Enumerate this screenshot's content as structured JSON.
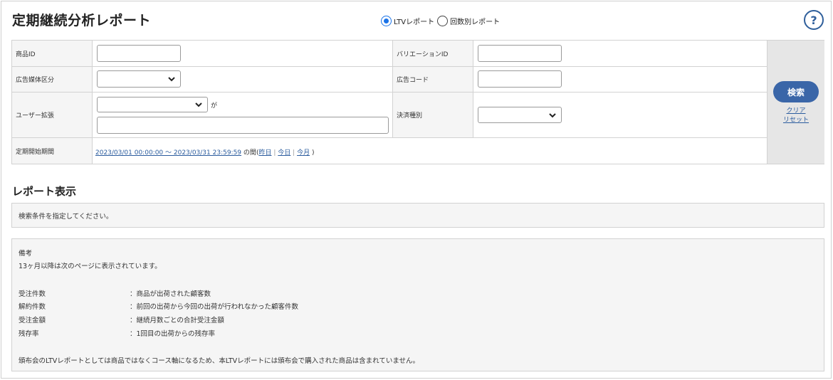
{
  "header": {
    "title": "定期継続分析レポート",
    "report_types": [
      {
        "label": "LTVレポート",
        "checked": true
      },
      {
        "label": "回数別レポート",
        "checked": false
      }
    ],
    "help_label": "?"
  },
  "search": {
    "product_id_label": "商品ID",
    "product_id_value": "",
    "variation_id_label": "バリエーションID",
    "variation_id_value": "",
    "ad_media_label": "広告媒体区分",
    "ad_media_value": "",
    "ad_code_label": "広告コード",
    "ad_code_value": "",
    "user_ext_label": "ユーザー拡張",
    "user_ext_select_value": "",
    "user_ext_ga": "が",
    "user_ext_text_value": "",
    "payment_label": "決済種別",
    "payment_value": "",
    "period_label": "定期開始期間",
    "period_range": "2023/03/01 00:00:00 ～ 2023/03/31 23:59:59",
    "period_suffix": "の間",
    "period_open": "(",
    "period_yesterday": "昨日",
    "period_sep1": "|",
    "period_today": "今日",
    "period_sep2": "|",
    "period_this_month": "今月",
    "period_close": ")",
    "search_button": "検索",
    "clear_link": "クリア",
    "reset_link": "リセット"
  },
  "report": {
    "section_title": "レポート表示",
    "message": "検索条件を指定してください。"
  },
  "notes": {
    "heading": "備考",
    "line1": "13ヶ月以降は次のページに表示されています。",
    "definitions": [
      {
        "term": "受注件数",
        "desc": "：商品が出荷された顧客数"
      },
      {
        "term": "解約件数",
        "desc": "：前回の出荷から今回の出荷が行われなかった顧客件数"
      },
      {
        "term": "受注金額",
        "desc": "：継続月数ごとの合計受注金額"
      },
      {
        "term": "残存率",
        "desc": "：1回目の出荷からの残存率"
      }
    ],
    "footer": "頒布会のLTVレポートとしては商品ではなくコース軸になるため、本LTVレポートには頒布会で購入された商品は含まれていません。"
  },
  "colors": {
    "accent": "#3a66a8",
    "radio_checked": "#1a73e8",
    "link": "#2b5c9e"
  }
}
